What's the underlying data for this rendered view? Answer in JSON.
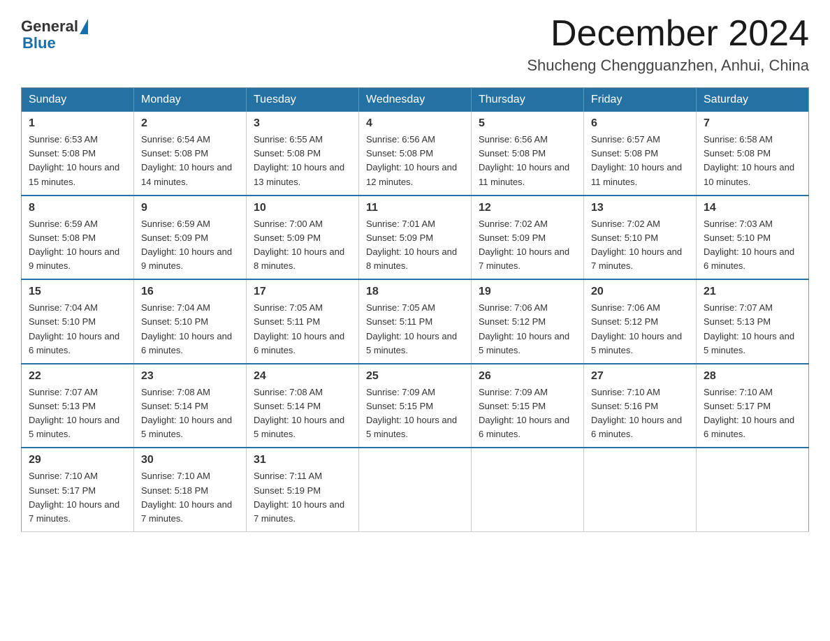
{
  "header": {
    "logo_general": "General",
    "logo_blue": "Blue",
    "month_title": "December 2024",
    "location": "Shucheng Chengguanzhen, Anhui, China"
  },
  "days_of_week": [
    "Sunday",
    "Monday",
    "Tuesday",
    "Wednesday",
    "Thursday",
    "Friday",
    "Saturday"
  ],
  "weeks": [
    [
      {
        "day": "1",
        "sunrise": "6:53 AM",
        "sunset": "5:08 PM",
        "daylight": "10 hours and 15 minutes."
      },
      {
        "day": "2",
        "sunrise": "6:54 AM",
        "sunset": "5:08 PM",
        "daylight": "10 hours and 14 minutes."
      },
      {
        "day": "3",
        "sunrise": "6:55 AM",
        "sunset": "5:08 PM",
        "daylight": "10 hours and 13 minutes."
      },
      {
        "day": "4",
        "sunrise": "6:56 AM",
        "sunset": "5:08 PM",
        "daylight": "10 hours and 12 minutes."
      },
      {
        "day": "5",
        "sunrise": "6:56 AM",
        "sunset": "5:08 PM",
        "daylight": "10 hours and 11 minutes."
      },
      {
        "day": "6",
        "sunrise": "6:57 AM",
        "sunset": "5:08 PM",
        "daylight": "10 hours and 11 minutes."
      },
      {
        "day": "7",
        "sunrise": "6:58 AM",
        "sunset": "5:08 PM",
        "daylight": "10 hours and 10 minutes."
      }
    ],
    [
      {
        "day": "8",
        "sunrise": "6:59 AM",
        "sunset": "5:08 PM",
        "daylight": "10 hours and 9 minutes."
      },
      {
        "day": "9",
        "sunrise": "6:59 AM",
        "sunset": "5:09 PM",
        "daylight": "10 hours and 9 minutes."
      },
      {
        "day": "10",
        "sunrise": "7:00 AM",
        "sunset": "5:09 PM",
        "daylight": "10 hours and 8 minutes."
      },
      {
        "day": "11",
        "sunrise": "7:01 AM",
        "sunset": "5:09 PM",
        "daylight": "10 hours and 8 minutes."
      },
      {
        "day": "12",
        "sunrise": "7:02 AM",
        "sunset": "5:09 PM",
        "daylight": "10 hours and 7 minutes."
      },
      {
        "day": "13",
        "sunrise": "7:02 AM",
        "sunset": "5:10 PM",
        "daylight": "10 hours and 7 minutes."
      },
      {
        "day": "14",
        "sunrise": "7:03 AM",
        "sunset": "5:10 PM",
        "daylight": "10 hours and 6 minutes."
      }
    ],
    [
      {
        "day": "15",
        "sunrise": "7:04 AM",
        "sunset": "5:10 PM",
        "daylight": "10 hours and 6 minutes."
      },
      {
        "day": "16",
        "sunrise": "7:04 AM",
        "sunset": "5:10 PM",
        "daylight": "10 hours and 6 minutes."
      },
      {
        "day": "17",
        "sunrise": "7:05 AM",
        "sunset": "5:11 PM",
        "daylight": "10 hours and 6 minutes."
      },
      {
        "day": "18",
        "sunrise": "7:05 AM",
        "sunset": "5:11 PM",
        "daylight": "10 hours and 5 minutes."
      },
      {
        "day": "19",
        "sunrise": "7:06 AM",
        "sunset": "5:12 PM",
        "daylight": "10 hours and 5 minutes."
      },
      {
        "day": "20",
        "sunrise": "7:06 AM",
        "sunset": "5:12 PM",
        "daylight": "10 hours and 5 minutes."
      },
      {
        "day": "21",
        "sunrise": "7:07 AM",
        "sunset": "5:13 PM",
        "daylight": "10 hours and 5 minutes."
      }
    ],
    [
      {
        "day": "22",
        "sunrise": "7:07 AM",
        "sunset": "5:13 PM",
        "daylight": "10 hours and 5 minutes."
      },
      {
        "day": "23",
        "sunrise": "7:08 AM",
        "sunset": "5:14 PM",
        "daylight": "10 hours and 5 minutes."
      },
      {
        "day": "24",
        "sunrise": "7:08 AM",
        "sunset": "5:14 PM",
        "daylight": "10 hours and 5 minutes."
      },
      {
        "day": "25",
        "sunrise": "7:09 AM",
        "sunset": "5:15 PM",
        "daylight": "10 hours and 5 minutes."
      },
      {
        "day": "26",
        "sunrise": "7:09 AM",
        "sunset": "5:15 PM",
        "daylight": "10 hours and 6 minutes."
      },
      {
        "day": "27",
        "sunrise": "7:10 AM",
        "sunset": "5:16 PM",
        "daylight": "10 hours and 6 minutes."
      },
      {
        "day": "28",
        "sunrise": "7:10 AM",
        "sunset": "5:17 PM",
        "daylight": "10 hours and 6 minutes."
      }
    ],
    [
      {
        "day": "29",
        "sunrise": "7:10 AM",
        "sunset": "5:17 PM",
        "daylight": "10 hours and 7 minutes."
      },
      {
        "day": "30",
        "sunrise": "7:10 AM",
        "sunset": "5:18 PM",
        "daylight": "10 hours and 7 minutes."
      },
      {
        "day": "31",
        "sunrise": "7:11 AM",
        "sunset": "5:19 PM",
        "daylight": "10 hours and 7 minutes."
      },
      null,
      null,
      null,
      null
    ]
  ]
}
